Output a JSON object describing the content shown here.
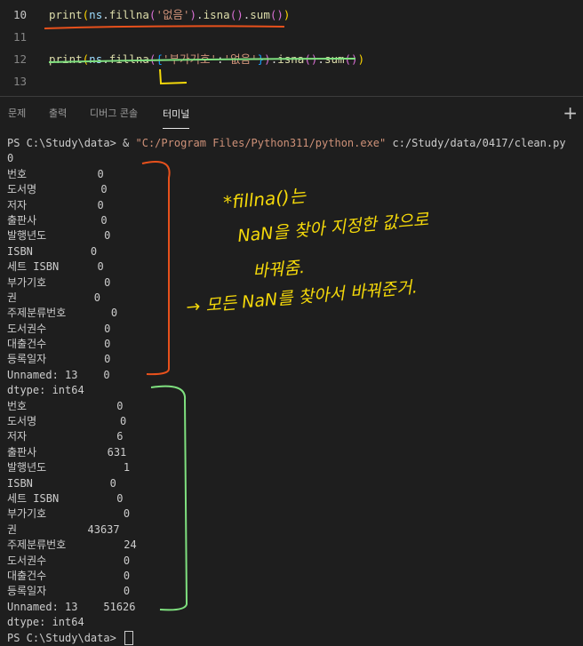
{
  "editor": {
    "lines": [
      {
        "num": "10",
        "active": true,
        "code": [
          [
            "fn",
            "print"
          ],
          [
            "pn",
            "("
          ],
          [
            "var",
            "ns"
          ],
          [
            "txt",
            "."
          ],
          [
            "fn",
            "fillna"
          ],
          [
            "pn2",
            "("
          ],
          [
            "str",
            "'없음'"
          ],
          [
            "pn2",
            ")"
          ],
          [
            "txt",
            "."
          ],
          [
            "fn",
            "isna"
          ],
          [
            "pn2",
            "()"
          ],
          [
            "txt",
            "."
          ],
          [
            "fn",
            "sum"
          ],
          [
            "pn2",
            "()"
          ],
          [
            "pn",
            ")"
          ]
        ]
      },
      {
        "num": "11",
        "active": false,
        "code": []
      },
      {
        "num": "12",
        "active": false,
        "code": [
          [
            "fn",
            "print"
          ],
          [
            "pn",
            "("
          ],
          [
            "var",
            "ns"
          ],
          [
            "txt",
            "."
          ],
          [
            "fn",
            "fillna"
          ],
          [
            "pn2",
            "("
          ],
          [
            "pn3",
            "{"
          ],
          [
            "str",
            "'부가기호'"
          ],
          [
            "txt",
            ":"
          ],
          [
            "str",
            "'없음'"
          ],
          [
            "pn3",
            "}"
          ],
          [
            "pn2",
            ")"
          ],
          [
            "txt",
            "."
          ],
          [
            "fn",
            "isna"
          ],
          [
            "pn2",
            "()"
          ],
          [
            "txt",
            "."
          ],
          [
            "fn",
            "sum"
          ],
          [
            "pn2",
            "()"
          ],
          [
            "pn",
            ")"
          ]
        ]
      },
      {
        "num": "13",
        "active": false,
        "code": []
      }
    ]
  },
  "panel_tabs": [
    {
      "label": "문제",
      "active": false
    },
    {
      "label": "출력",
      "active": false
    },
    {
      "label": "디버그 콘솔",
      "active": false
    },
    {
      "label": "터미널",
      "active": true
    }
  ],
  "panel_plus": "+",
  "terminal": {
    "command_prompt": "PS C:\\Study\\data> & ",
    "command_exe": "\"C:/Program Files/Python311/python.exe\"",
    "command_script": " c:/Study/data/0417/clean.py",
    "output1": [
      "0",
      "번호           0",
      "도서명          0",
      "저자           0",
      "출판사          0",
      "발행년도         0",
      "ISBN         0",
      "세트 ISBN      0",
      "부가기호         0",
      "권            0",
      "주제분류번호       0",
      "도서권수         0",
      "대출건수         0",
      "등록일자         0",
      "Unnamed: 13    0",
      "dtype: int64"
    ],
    "output2": [
      "번호              0",
      "도서명             0",
      "저자              6",
      "출판사           631",
      "발행년도            1",
      "ISBN            0",
      "세트 ISBN         0",
      "부가기호            0",
      "권           43637",
      "주제분류번호         24",
      "도서권수            0",
      "대출건수            0",
      "등록일자            0",
      "Unnamed: 13    51626",
      "dtype: int64"
    ],
    "final_prompt": "PS C:\\Study\\data> "
  },
  "annotations": {
    "line1": "*fillna()는",
    "line2": "NaN을  찾아 지정한 값으로",
    "line3": "바꿔줌.",
    "line4": "→ 모든 NaN를  찾아서 바꿔준거."
  },
  "colors": {
    "orange_pen": "#e8511c",
    "green_pen": "#7fe07f",
    "yellow_pen": "#f5d90a"
  }
}
